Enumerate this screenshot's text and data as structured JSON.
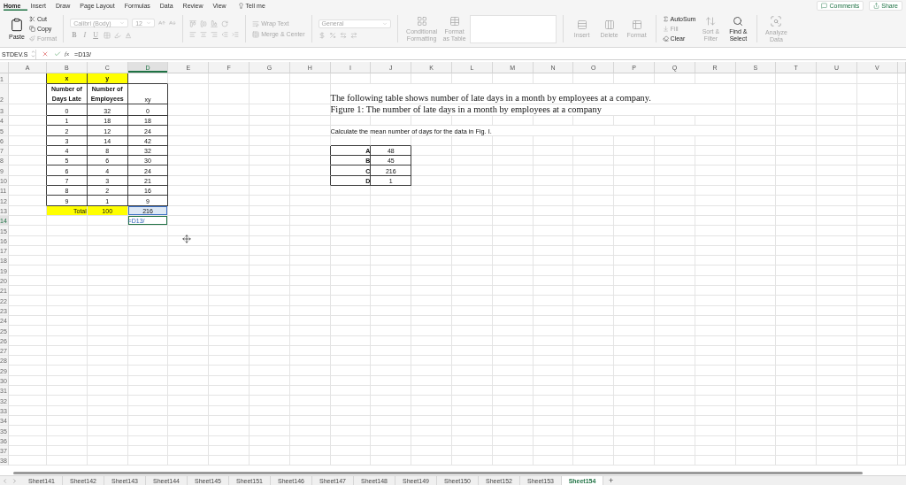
{
  "menu_tabs": [
    {
      "label": "Home",
      "selected": true
    },
    {
      "label": "Insert",
      "selected": false
    },
    {
      "label": "Draw",
      "selected": false
    },
    {
      "label": "Page Layout",
      "selected": false
    },
    {
      "label": "Formulas",
      "selected": false
    },
    {
      "label": "Data",
      "selected": false
    },
    {
      "label": "Review",
      "selected": false
    },
    {
      "label": "View",
      "selected": false
    }
  ],
  "tell_me": "Tell me",
  "comments": "Comments",
  "share": "Share",
  "ribbon": {
    "paste": {
      "label": "Paste",
      "disabled": false
    },
    "cut": {
      "label": "Cut",
      "disabled": false
    },
    "copy": {
      "label": "Copy",
      "disabled": false
    },
    "format_painter": {
      "label": "Format",
      "disabled": true
    },
    "font": {
      "value": "Calibri (Body)",
      "disabled": true
    },
    "font_size": {
      "value": "12",
      "disabled": true
    },
    "font_styles": [
      {
        "label": "B",
        "disabled": true
      },
      {
        "label": "I",
        "disabled": true
      },
      {
        "label": "U",
        "disabled": true
      }
    ],
    "alignment": {
      "disabled": true
    },
    "wrap_text": {
      "label": "Wrap Text",
      "disabled": true
    },
    "merge_center": {
      "label": "Merge & Center",
      "disabled": true
    },
    "number_format": {
      "value": "General",
      "disabled": true
    },
    "conditional_formatting": {
      "label": "Conditional Formatting",
      "disabled": true
    },
    "format_as_table": {
      "label": "Format as Table",
      "disabled": true
    },
    "insert": {
      "label": "Insert",
      "disabled": true
    },
    "delete": {
      "label": "Delete",
      "disabled": true
    },
    "format": {
      "label": "Format",
      "disabled": true
    },
    "autosum": {
      "label": "AutoSum",
      "disabled": false
    },
    "fill": {
      "label": "Fill",
      "disabled": true
    },
    "clear": {
      "label": "Clear",
      "disabled": false
    },
    "sort_filter": {
      "label": "Sort & Filter",
      "disabled": true
    },
    "find_select": {
      "label": "Find & Select",
      "disabled": false
    },
    "analyze_data": {
      "label": "Analyze Data",
      "disabled": true
    }
  },
  "formula_bar": {
    "name_box": "STDEV.S",
    "fx": "fx",
    "formula": "=D13/"
  },
  "columns": [
    {
      "letter": "A",
      "active": false
    },
    {
      "letter": "B",
      "active": false
    },
    {
      "letter": "C",
      "active": false
    },
    {
      "letter": "D",
      "active": true
    },
    {
      "letter": "E",
      "active": false
    },
    {
      "letter": "F",
      "active": false
    },
    {
      "letter": "G",
      "active": false
    },
    {
      "letter": "H",
      "active": false
    },
    {
      "letter": "I",
      "active": false
    },
    {
      "letter": "J",
      "active": false
    },
    {
      "letter": "K",
      "active": false
    },
    {
      "letter": "L",
      "active": false
    },
    {
      "letter": "M",
      "active": false
    },
    {
      "letter": "N",
      "active": false
    },
    {
      "letter": "O",
      "active": false
    },
    {
      "letter": "P",
      "active": false
    },
    {
      "letter": "Q",
      "active": false
    },
    {
      "letter": "R",
      "active": false
    },
    {
      "letter": "S",
      "active": false
    },
    {
      "letter": "T",
      "active": false
    },
    {
      "letter": "U",
      "active": false
    },
    {
      "letter": "V",
      "active": false
    }
  ],
  "rows": [
    {
      "number": "1",
      "active": false,
      "cells": {
        "B": {
          "text": "x",
          "kind": "heading",
          "highlighted": true,
          "bordered": true
        },
        "C": {
          "text": "y",
          "kind": "heading",
          "highlighted": true,
          "bordered": true
        }
      }
    },
    {
      "number": "2",
      "active": false,
      "cells": {
        "B": {
          "text": "Number of Days Late",
          "kind": "heading",
          "highlighted": false,
          "bordered": true
        },
        "C": {
          "text": "Number of Employees",
          "kind": "heading",
          "highlighted": false,
          "bordered": true
        },
        "D": {
          "text": "xy",
          "kind": "value",
          "highlighted": false,
          "bordered": true
        },
        "I": {
          "text": "The following table shows number of late days in a month by employees at a company.",
          "kind": "note",
          "highlighted": false,
          "bordered": false
        }
      }
    },
    {
      "number": "3",
      "active": false,
      "cells": {
        "B": {
          "text": "0",
          "kind": "value",
          "highlighted": false,
          "bordered": true
        },
        "C": {
          "text": "32",
          "kind": "value",
          "highlighted": false,
          "bordered": true
        },
        "D": {
          "text": "0",
          "kind": "value",
          "highlighted": false,
          "bordered": true
        },
        "I": {
          "text": "Figure 1: The number of late days in a month by employees at a company",
          "kind": "note",
          "highlighted": false,
          "bordered": false
        }
      }
    },
    {
      "number": "4",
      "active": false,
      "cells": {
        "B": {
          "text": "1",
          "kind": "value",
          "highlighted": false,
          "bordered": true
        },
        "C": {
          "text": "18",
          "kind": "value",
          "highlighted": false,
          "bordered": true
        },
        "D": {
          "text": "18",
          "kind": "value",
          "highlighted": false,
          "bordered": true
        }
      }
    },
    {
      "number": "5",
      "active": false,
      "cells": {
        "B": {
          "text": "2",
          "kind": "value",
          "highlighted": false,
          "bordered": true
        },
        "C": {
          "text": "12",
          "kind": "value",
          "highlighted": false,
          "bordered": true
        },
        "D": {
          "text": "24",
          "kind": "value",
          "highlighted": false,
          "bordered": true
        },
        "I": {
          "text": "Calculate the mean number of days for the data in Fig. I.",
          "kind": "prompt",
          "highlighted": false,
          "bordered": false
        }
      }
    },
    {
      "number": "6",
      "active": false,
      "cells": {
        "B": {
          "text": "3",
          "kind": "value",
          "highlighted": false,
          "bordered": true
        },
        "C": {
          "text": "14",
          "kind": "value",
          "highlighted": false,
          "bordered": true
        },
        "D": {
          "text": "42",
          "kind": "value",
          "highlighted": false,
          "bordered": true
        }
      }
    },
    {
      "number": "7",
      "active": false,
      "cells": {
        "B": {
          "text": "4",
          "kind": "value",
          "highlighted": false,
          "bordered": true
        },
        "C": {
          "text": "8",
          "kind": "value",
          "highlighted": false,
          "bordered": true
        },
        "D": {
          "text": "32",
          "kind": "value",
          "highlighted": false,
          "bordered": true
        },
        "I": {
          "text": "A",
          "kind": "option",
          "highlighted": false,
          "bordered": true
        },
        "J": {
          "text": "48",
          "kind": "value",
          "highlighted": false,
          "bordered": true
        }
      }
    },
    {
      "number": "8",
      "active": false,
      "cells": {
        "B": {
          "text": "5",
          "kind": "value",
          "highlighted": false,
          "bordered": true
        },
        "C": {
          "text": "6",
          "kind": "value",
          "highlighted": false,
          "bordered": true
        },
        "D": {
          "text": "30",
          "kind": "value",
          "highlighted": false,
          "bordered": true
        },
        "I": {
          "text": "B",
          "kind": "option",
          "highlighted": false,
          "bordered": true
        },
        "J": {
          "text": "45",
          "kind": "value",
          "highlighted": false,
          "bordered": true
        }
      }
    },
    {
      "number": "9",
      "active": false,
      "cells": {
        "B": {
          "text": "6",
          "kind": "value",
          "highlighted": false,
          "bordered": true
        },
        "C": {
          "text": "4",
          "kind": "value",
          "highlighted": false,
          "bordered": true
        },
        "D": {
          "text": "24",
          "kind": "value",
          "highlighted": false,
          "bordered": true
        },
        "I": {
          "text": "C",
          "kind": "option",
          "highlighted": false,
          "bordered": true
        },
        "J": {
          "text": "216",
          "kind": "value",
          "highlighted": false,
          "bordered": true
        }
      }
    },
    {
      "number": "10",
      "active": false,
      "cells": {
        "B": {
          "text": "7",
          "kind": "value",
          "highlighted": false,
          "bordered": true
        },
        "C": {
          "text": "3",
          "kind": "value",
          "highlighted": false,
          "bordered": true
        },
        "D": {
          "text": "21",
          "kind": "value",
          "highlighted": false,
          "bordered": true
        },
        "I": {
          "text": "D",
          "kind": "option",
          "highlighted": false,
          "bordered": true
        },
        "J": {
          "text": "1",
          "kind": "value",
          "highlighted": false,
          "bordered": true
        }
      }
    },
    {
      "number": "11",
      "active": false,
      "cells": {
        "B": {
          "text": "8",
          "kind": "value",
          "highlighted": false,
          "bordered": true
        },
        "C": {
          "text": "2",
          "kind": "value",
          "highlighted": false,
          "bordered": true
        },
        "D": {
          "text": "16",
          "kind": "value",
          "highlighted": false,
          "bordered": true
        }
      }
    },
    {
      "number": "12",
      "active": false,
      "cells": {
        "B": {
          "text": "9",
          "kind": "value",
          "highlighted": false,
          "bordered": true
        },
        "C": {
          "text": "1",
          "kind": "value",
          "highlighted": false,
          "bordered": true
        },
        "D": {
          "text": "9",
          "kind": "value",
          "highlighted": false,
          "bordered": true
        }
      }
    },
    {
      "number": "13",
      "active": false,
      "cells": {
        "B": {
          "text": "Total",
          "kind": "label",
          "highlighted": true,
          "bordered": false
        },
        "C": {
          "text": "100",
          "kind": "value",
          "highlighted": true,
          "bordered": false
        },
        "D": {
          "text": "216",
          "kind": "reference",
          "highlighted": false,
          "bordered": false
        }
      }
    },
    {
      "number": "14",
      "active": true,
      "cells": {
        "D": {
          "text": "=D13/",
          "kind": "formula",
          "highlighted": false,
          "bordered": false
        }
      }
    },
    {
      "number": "15",
      "active": false
    },
    {
      "number": "16",
      "active": false
    },
    {
      "number": "17",
      "active": false
    },
    {
      "number": "18",
      "active": false
    },
    {
      "number": "19",
      "active": false
    },
    {
      "number": "20",
      "active": false
    },
    {
      "number": "21",
      "active": false
    },
    {
      "number": "22",
      "active": false
    },
    {
      "number": "23",
      "active": false
    },
    {
      "number": "24",
      "active": false
    },
    {
      "number": "25",
      "active": false
    },
    {
      "number": "26",
      "active": false
    },
    {
      "number": "27",
      "active": false
    },
    {
      "number": "28",
      "active": false
    },
    {
      "number": "29",
      "active": false
    },
    {
      "number": "30",
      "active": false
    },
    {
      "number": "31",
      "active": false
    },
    {
      "number": "32",
      "active": false
    },
    {
      "number": "33",
      "active": false
    },
    {
      "number": "34",
      "active": false
    },
    {
      "number": "35",
      "active": false
    },
    {
      "number": "36",
      "active": false
    },
    {
      "number": "37",
      "active": false
    },
    {
      "number": "38",
      "active": false
    }
  ],
  "sheet_tabs": [
    {
      "label": "Sheet141",
      "selected": false
    },
    {
      "label": "Sheet142",
      "selected": false
    },
    {
      "label": "Sheet143",
      "selected": false
    },
    {
      "label": "Sheet144",
      "selected": false
    },
    {
      "label": "Sheet145",
      "selected": false
    },
    {
      "label": "Sheet151",
      "selected": false
    },
    {
      "label": "Sheet146",
      "selected": false
    },
    {
      "label": "Sheet147",
      "selected": false
    },
    {
      "label": "Sheet148",
      "selected": false
    },
    {
      "label": "Sheet149",
      "selected": false
    },
    {
      "label": "Sheet150",
      "selected": false
    },
    {
      "label": "Sheet152",
      "selected": false
    },
    {
      "label": "Sheet153",
      "selected": false
    },
    {
      "label": "Sheet154",
      "selected": true
    }
  ],
  "add_sheet": "+"
}
